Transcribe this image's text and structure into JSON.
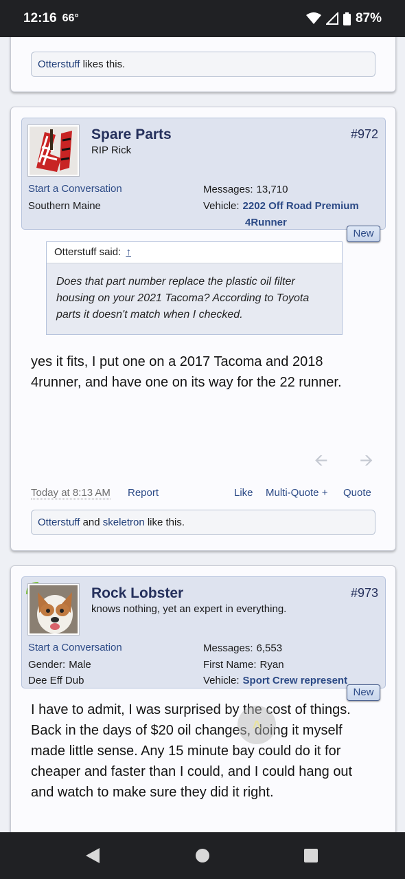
{
  "status": {
    "time": "12:16",
    "temp": "66°",
    "battery": "87%"
  },
  "prev_post": {
    "likes_user": "Otterstuff",
    "likes_suffix": " likes this."
  },
  "posts": [
    {
      "username": "Spare Parts",
      "user_title": "RIP Rick",
      "post_number": "#972",
      "start_conversation": "Start a Conversation",
      "location": "Southern Maine",
      "messages_label": "Messages:",
      "messages_value": "13,710",
      "vehicle_label": "Vehicle:",
      "vehicle_line1": "2202 Off Road Premium",
      "vehicle_line2": "4Runner",
      "new_badge": "New",
      "quote_author": "Otterstuff said:",
      "quote_arrow": "↑",
      "quote_text": "Does that part number replace the plastic oil filter housing on your 2021 Tacoma? According to Toyota parts it doesn't match when I checked.",
      "message": "yes it fits, I put one on a 2017 Tacoma and 2018 4runner, and have one on its way for the 22 runner.",
      "timestamp": "Today at 8:13 AM",
      "report": "Report",
      "like": "Like",
      "multiquote": "Multi-Quote +",
      "quote": "Quote",
      "likes_user1": "Otterstuff",
      "likes_and": " and ",
      "likes_user2": "skeletron",
      "likes_suffix": " like this."
    },
    {
      "username": "Rock Lobster",
      "user_title": "knows nothing, yet an expert in everything.",
      "post_number": "#973",
      "start_conversation": "Start a Conversation",
      "gender_label": "Gender:",
      "gender_value": "Male",
      "location": "Dee Eff Dub",
      "messages_label": "Messages:",
      "messages_value": "6,553",
      "firstname_label": "First Name:",
      "firstname_value": "Ryan",
      "vehicle_label": "Vehicle:",
      "vehicle_value": "Sport Crew represent",
      "new_badge": "New",
      "message": "I have to admit, I was surprised by the cost of things. Back in the days of $20 oil changes, doing it myself made little sense. Any 15 minute bay could do it for cheaper and faster than I could, and I could hang out and watch to make sure they did it right."
    }
  ],
  "colors": {
    "link": "#2c4a86",
    "username": "#25305c",
    "panel": "#dee3ef"
  }
}
